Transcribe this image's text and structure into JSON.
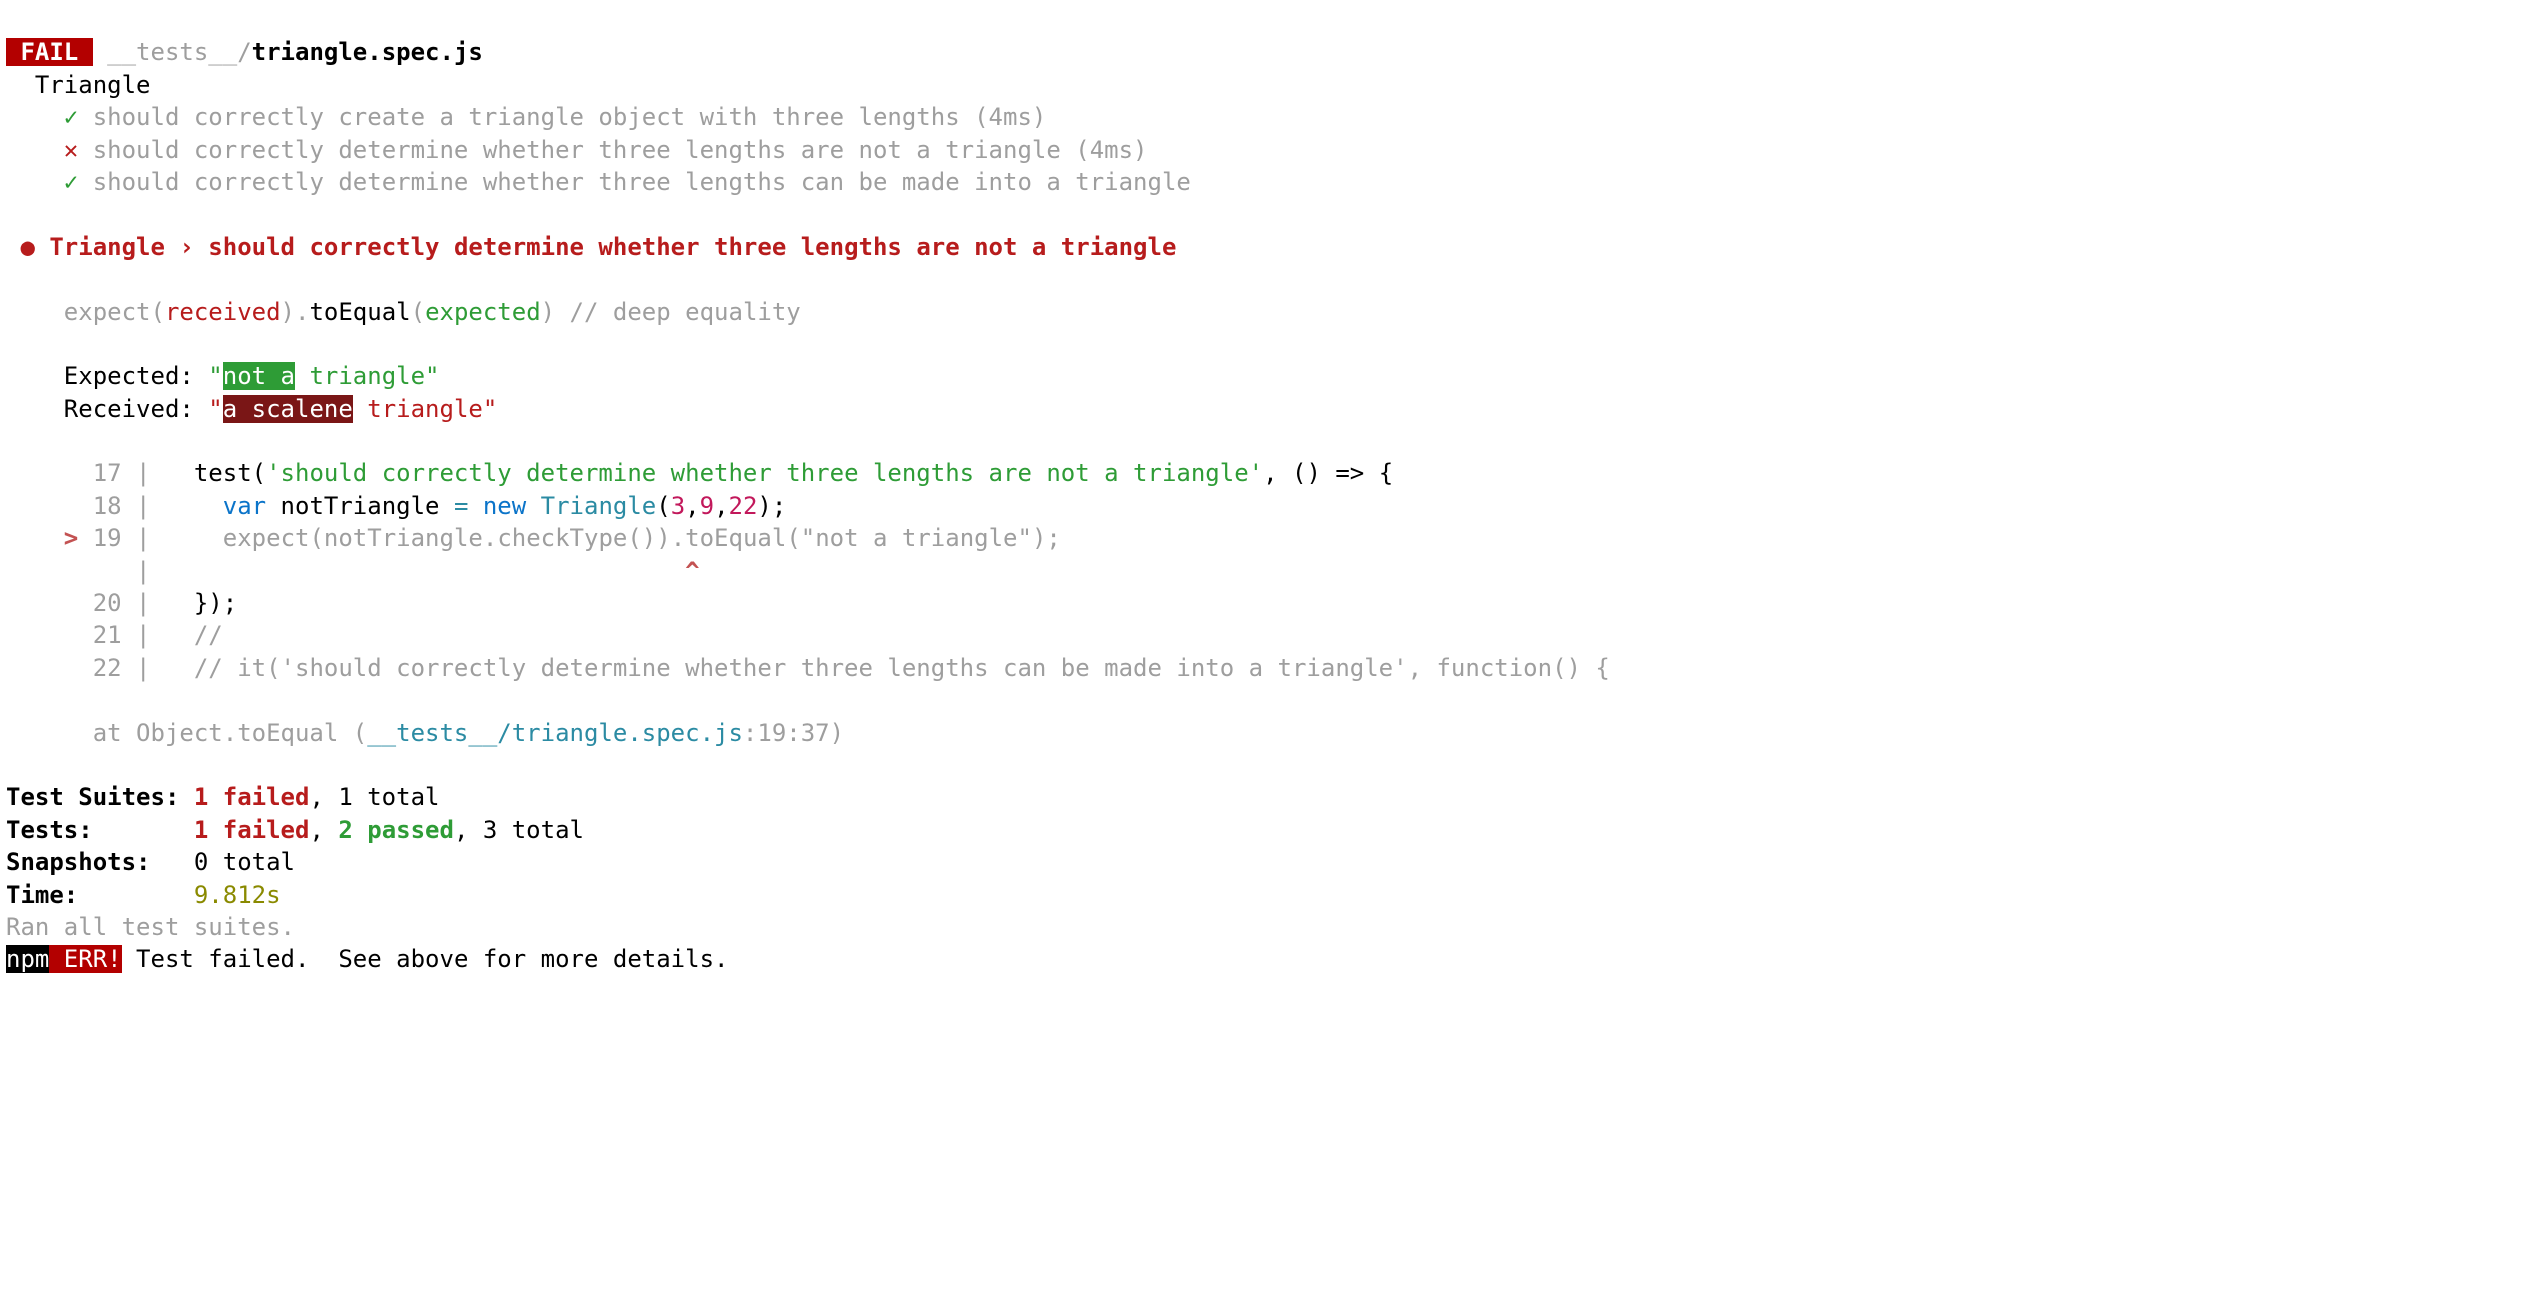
{
  "fail_badge": " FAIL ",
  "test_path_prefix": " __tests__/",
  "test_file": "triangle.spec.js",
  "suite_name": "  Triangle",
  "tests": {
    "t1": {
      "mark": "✓",
      "text": "should correctly create a triangle object with three lengths (4ms)"
    },
    "t2": {
      "mark": "✕",
      "text": "should correctly determine whether three lengths are not a triangle (4ms)"
    },
    "t3": {
      "mark": "✓",
      "text": "should correctly determine whether three lengths can be made into a triangle"
    }
  },
  "fail_header": {
    "bullet": "●",
    "text": "Triangle › should correctly determine whether three lengths are not a triangle"
  },
  "matcher": {
    "expect": "expect(",
    "received": "received",
    "dot": ").",
    "toEqual": "toEqual",
    "open": "(",
    "expected": "expected",
    "close_comment": ") // deep equality"
  },
  "diff": {
    "expected_label": "Expected: ",
    "received_label": "Received: ",
    "exp_open_q": "\"",
    "exp_hl": "not a",
    "exp_rest": " triangle\"",
    "rec_open_q": "\"",
    "rec_hl": "a scalene",
    "rec_rest": " triangle\""
  },
  "code": {
    "l17": {
      "num": "      17",
      "sep": " |   ",
      "text_a": "test(",
      "str": "'should correctly determine whether three lengths are not a triangle'",
      "text_b": ", () => {"
    },
    "l18": {
      "num": "      18",
      "sep": " |     ",
      "var": "var",
      "id": " notTriangle ",
      "eq": "=",
      "newkw": " new",
      "cls": " Triangle",
      "open": "(",
      "n1": "3",
      "c1": ",",
      "n2": "9",
      "c2": ",",
      "n3": "22",
      "close": ");"
    },
    "l19": {
      "marker": "    >",
      "num": " 19",
      "sep": " |     ",
      "expect": "expect(notTriangle",
      "dot": ".",
      "method": "checkType())",
      "dot2": ".",
      "toEqual": "toEqual",
      "open": "(",
      "arg": "\"not a triangle\"",
      "close": ");"
    },
    "caret": {
      "pipe": "         |                                     ",
      "caret": "^"
    },
    "l20": {
      "num": "      20",
      "sep": " |   ",
      "text": "});"
    },
    "l21": {
      "num": "      21",
      "sep": " |   ",
      "text": "//"
    },
    "l22": {
      "num": "      22",
      "sep": " |   ",
      "text": "// it('should correctly determine whether three lengths can be made into a triangle', function() {"
    }
  },
  "stack": {
    "at": "      at Object.toEqual (",
    "file": "__tests__/triangle.spec.js",
    "loc": ":19:37)"
  },
  "summary": {
    "suites_label": "Test Suites: ",
    "suites_failed": "1 failed",
    "suites_rest": ", 1 total",
    "tests_label": "Tests:       ",
    "tests_failed": "1 failed",
    "tests_sep": ", ",
    "tests_passed": "2 passed",
    "tests_rest": ", 3 total",
    "snapshots_label": "Snapshots:   ",
    "snapshots_value": "0 total",
    "time_label": "Time:        ",
    "time_value": "9.812s",
    "ran": "Ran all test suites."
  },
  "npm": {
    "tag": "npm",
    "err": " ERR!",
    "msg": " Test failed.  See above for more details."
  },
  "sp": " ",
  "nl": "",
  "indent4": "    ",
  "indent6": "      "
}
